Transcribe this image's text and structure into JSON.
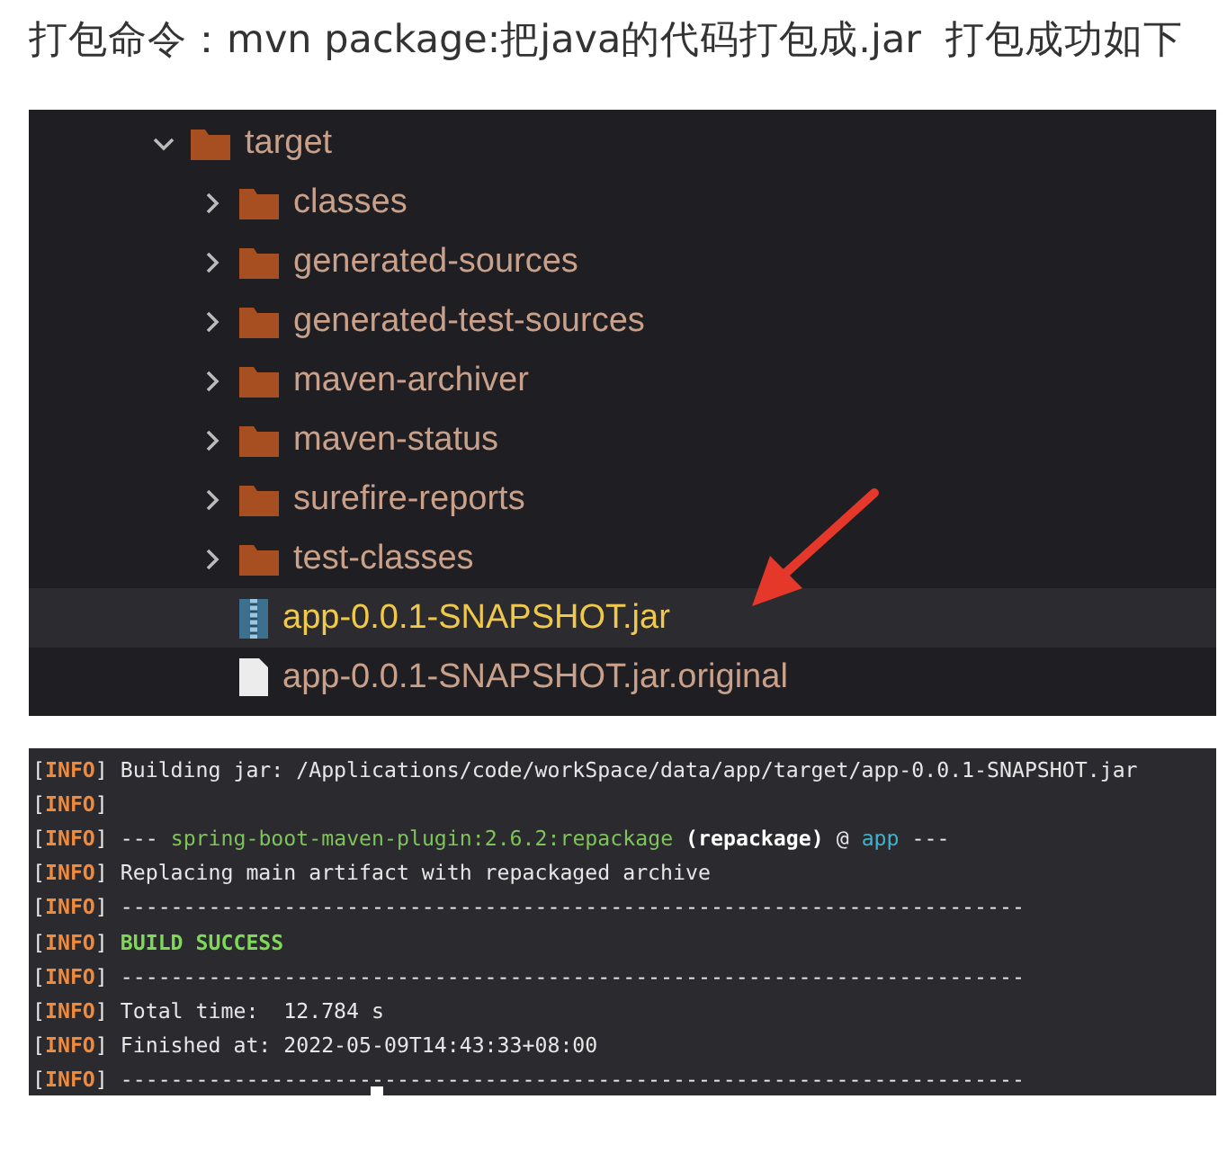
{
  "intro": "打包命令：mvn package:把java的代码打包成.jar  打包成功如下",
  "tree": [
    {
      "kind": "folder",
      "name": "target",
      "expanded": true,
      "selected": false,
      "children": [
        {
          "kind": "folder",
          "name": "classes",
          "expanded": false,
          "selected": false
        },
        {
          "kind": "folder",
          "name": "generated-sources",
          "expanded": false,
          "selected": false
        },
        {
          "kind": "folder",
          "name": "generated-test-sources",
          "expanded": false,
          "selected": false
        },
        {
          "kind": "folder",
          "name": "maven-archiver",
          "expanded": false,
          "selected": false
        },
        {
          "kind": "folder",
          "name": "maven-status",
          "expanded": false,
          "selected": false
        },
        {
          "kind": "folder",
          "name": "surefire-reports",
          "expanded": false,
          "selected": false
        },
        {
          "kind": "folder",
          "name": "test-classes",
          "expanded": false,
          "selected": false
        },
        {
          "kind": "jar",
          "name": "app-0.0.1-SNAPSHOT.jar",
          "selected": true
        },
        {
          "kind": "file",
          "name": "app-0.0.1-SNAPSHOT.jar.original",
          "selected": false
        }
      ]
    }
  ],
  "terminal": [
    {
      "tag": [
        "[",
        "INFO",
        "]"
      ],
      "segments": [
        {
          "kind": "plain",
          "text": "Building jar: /Applications/code/workSpace/data/app/target/app-0.0.1-SNAPSHOT.jar"
        }
      ]
    },
    {
      "tag": [
        "[",
        "INFO",
        "]"
      ]
    },
    {
      "tag": [
        "[",
        "INFO",
        "]"
      ],
      "segments": [
        {
          "kind": "plain",
          "text": "---"
        },
        {
          "kind": "plugin",
          "text": "spring-boot-maven-plugin:2.6.2:repackage"
        },
        {
          "kind": "bold",
          "text": "(repackage)"
        },
        {
          "kind": "plain",
          "text": "@"
        },
        {
          "kind": "project",
          "text": "app"
        },
        {
          "kind": "plain",
          "text": "---"
        }
      ]
    },
    {
      "tag": [
        "[",
        "INFO",
        "]"
      ],
      "segments": [
        {
          "kind": "plain",
          "text": "Replacing main artifact with repackaged archive"
        }
      ]
    },
    {
      "tag": [
        "[",
        "INFO",
        "]"
      ],
      "segments": [
        {
          "kind": "plain",
          "text": "------------------------------------------------------------------------"
        }
      ]
    },
    {
      "tag": [
        "[",
        "INFO",
        "]"
      ],
      "segments": [
        {
          "kind": "success",
          "text": "BUILD SUCCESS"
        }
      ]
    },
    {
      "tag": [
        "[",
        "INFO",
        "]"
      ],
      "segments": [
        {
          "kind": "plain",
          "text": "------------------------------------------------------------------------"
        }
      ]
    },
    {
      "tag": [
        "[",
        "INFO",
        "]"
      ],
      "segments": [
        {
          "kind": "plain",
          "text": "Total time:  12.784 s"
        }
      ]
    },
    {
      "tag": [
        "[",
        "INFO",
        "]"
      ],
      "segments": [
        {
          "kind": "plain",
          "text": "Finished at: 2022-05-09T14:43:33+08:00"
        }
      ]
    },
    {
      "tag": [
        "[",
        "INFO",
        "]"
      ],
      "segments": [
        {
          "kind": "plain",
          "text": "------------------------------------------------------------------------"
        }
      ]
    }
  ]
}
